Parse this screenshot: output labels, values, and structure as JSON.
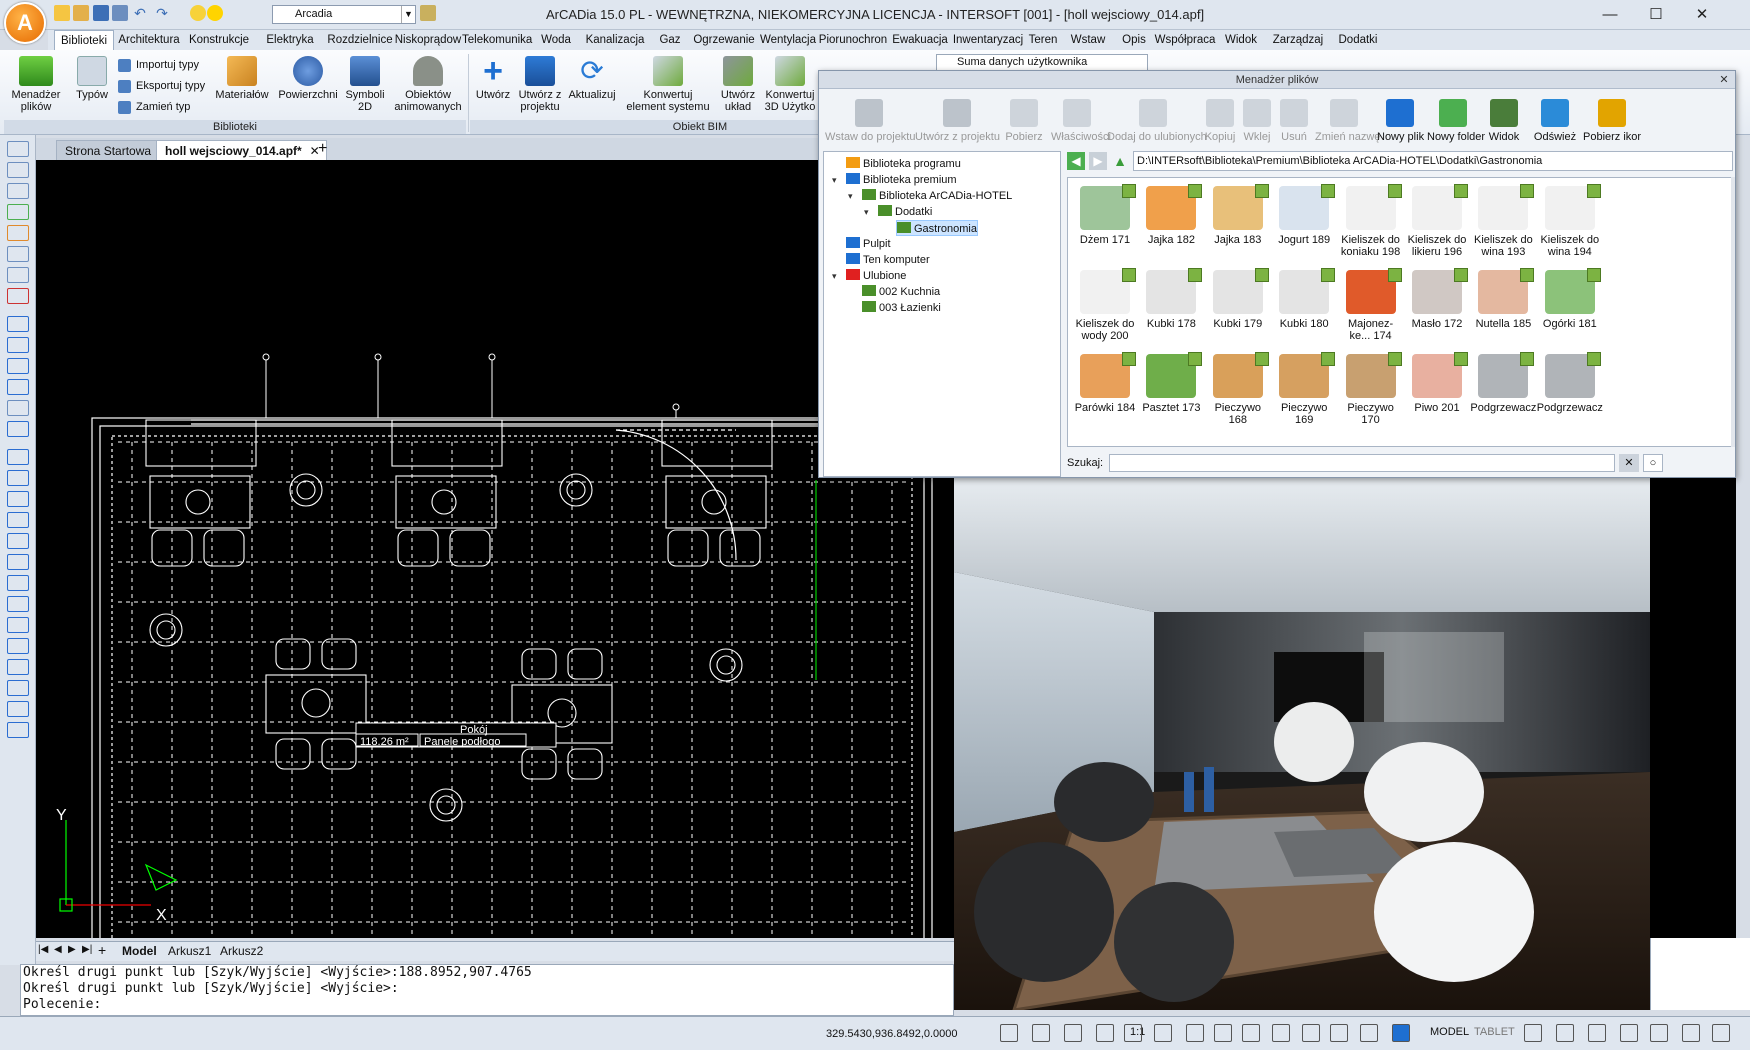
{
  "window": {
    "title": "ArCADia 15.0 PL - WEWNĘTRZNA, NIEKOMERCYJNA LICENCJA - INTERSOFT [001] - [holl wejsciowy_014.apf]",
    "layer": "Arcadia",
    "logo_letter": "A"
  },
  "menu_tabs": [
    "Biblioteki",
    "Architektura",
    "Konstrukcje",
    "Elektryka",
    "Rozdzielnice",
    "Niskoprądow",
    "Telekomunika",
    "Woda",
    "Kanalizacja",
    "Gaz",
    "Ogrzewanie",
    "Wentylacja",
    "Piorunochron",
    "Ewakuacja",
    "Inwentaryzacj",
    "Teren",
    "Wstaw",
    "Opis",
    "Współpraca",
    "Widok",
    "Zarządzaj",
    "Dodatki"
  ],
  "ribbon": {
    "menadzer": "Menadżer\nplików",
    "typow": "Typów",
    "importuj": "Importuj typy",
    "eksportuj": "Eksportuj typy",
    "zamien": "Zamień typ",
    "materialow": "Materiałów",
    "powierzchni": "Powierzchni",
    "symboli": "Symboli\n2D",
    "obiektow": "Obiektów\nanimowanych",
    "utworz": "Utwórz",
    "utworz_z_projektu": "Utwórz z\nprojektu",
    "aktualizuj": "Aktualizuj",
    "konwertuj_element": "Konwertuj\nelement systemu",
    "utworz_uklad": "Utwórz\nukład",
    "konwertuj_3d": "Konwertuj\n3D Użytko",
    "group_biblioteki": "Biblioteki",
    "group_bim": "Obiekt BIM",
    "suma_danych": "Suma danych użytkownika"
  },
  "doc_tabs": {
    "start": "Strona Startowa",
    "active": "holl wejsciowy_014.apf*"
  },
  "cad": {
    "tabs": [
      "Model",
      "Arkusz1",
      "Arkusz2"
    ],
    "room_name": "Pokój",
    "area": "118.26 m²",
    "floor": "Panele podłogo"
  },
  "command": {
    "line1": "Określ drugi punkt lub [Szyk/Wyjście] <Wyjście>:188.8952,907.4765",
    "line2": "Określ drugi punkt lub [Szyk/Wyjście] <Wyjście>:",
    "prompt": "Polecenie:"
  },
  "status": {
    "coords": "329.5430,936.8492,0.0000",
    "scale": "1:1",
    "model": "MODEL",
    "tablet": "TABLET"
  },
  "file_manager": {
    "title": "Menadżer plików",
    "toolbar": [
      {
        "label": "Wstaw do projektu",
        "enabled": false
      },
      {
        "label": "Utwórz z projektu",
        "enabled": false
      },
      {
        "label": "Pobierz",
        "enabled": false
      },
      {
        "label": "Właściwości",
        "enabled": false
      },
      {
        "label": "Dodaj do ulubionych",
        "enabled": false
      },
      {
        "label": "Kopiuj",
        "enabled": false
      },
      {
        "label": "Wklej",
        "enabled": false
      },
      {
        "label": "Usuń",
        "enabled": false
      },
      {
        "label": "Zmień nazwę",
        "enabled": false
      },
      {
        "label": "Nowy plik",
        "enabled": true
      },
      {
        "label": "Nowy folder",
        "enabled": true
      },
      {
        "label": "Widok",
        "enabled": true
      },
      {
        "label": "Odśwież",
        "enabled": true
      },
      {
        "label": "Pobierz ikor",
        "enabled": true
      }
    ],
    "tree": [
      "Biblioteka programu",
      "Biblioteka premium",
      "Biblioteka ArCADia-HOTEL",
      "Dodatki",
      "Gastronomia",
      "Pulpit",
      "Ten komputer",
      "Ulubione",
      "002 Kuchnia",
      "003 Łazienki"
    ],
    "path": "D:\\INTERsoft\\Biblioteka\\Premium\\Biblioteka ArCADia-HOTEL\\Dodatki\\Gastronomia",
    "items": [
      "Dżem 171",
      "Jajka 182",
      "Jajka 183",
      "Jogurt 189",
      "Kieliszek do koniaku 198",
      "Kieliszek do likieru 196",
      "Kieliszek do wina 193",
      "Kieliszek do wina 194",
      "Kieliszek do wody 200",
      "Kubki 178",
      "Kubki 179",
      "Kubki 180",
      "Majonez-ke... 174",
      "Masło 172",
      "Nutella 185",
      "Ogórki 181",
      "Parówki 184",
      "Pasztet 173",
      "Pieczywo 168",
      "Pieczywo 169",
      "Pieczywo 170",
      "Piwo 201",
      "Podgrzewacz",
      "Podgrzewacz"
    ],
    "search_label": "Szukaj:"
  },
  "colors": {
    "accent": "#1e6fd1",
    "cad_bg": "#000000",
    "ribbon_bg": "#eef2f7",
    "cube": "#7cb342"
  }
}
